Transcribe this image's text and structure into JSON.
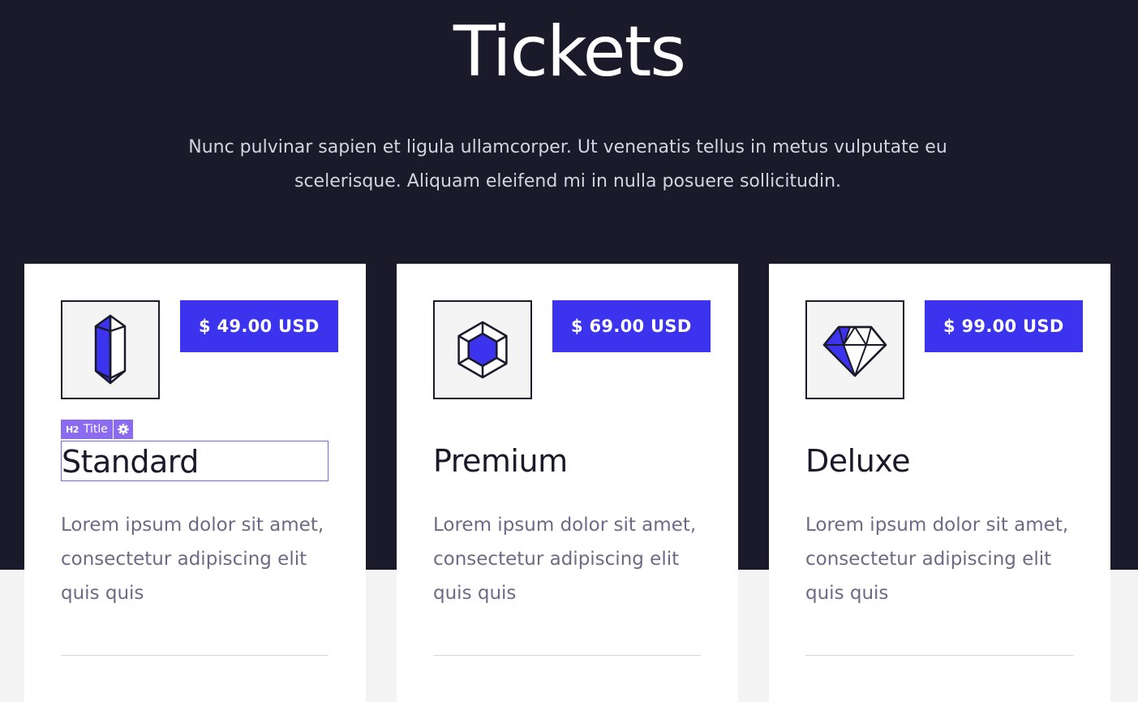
{
  "hero": {
    "title": "Tickets",
    "subtitle": "Nunc pulvinar sapien et ligula ullamcorper. Ut venenatis tellus in metus vulputate eu scelerisque. Aliquam eleifend mi in nulla posuere sollicitudin."
  },
  "editor_tag": {
    "heading_level": "H2",
    "label": "Title",
    "settings_icon": "gear-icon"
  },
  "cards": [
    {
      "icon": "crystal-icon",
      "price": "$ 49.00 USD",
      "title": "Standard",
      "text": "Lorem ipsum dolor sit amet, consectetur adipiscing elit quis quis"
    },
    {
      "icon": "hexagon-gem-icon",
      "price": "$ 69.00 USD",
      "title": "Premium",
      "text": "Lorem ipsum dolor sit amet, consectetur adipiscing elit quis quis"
    },
    {
      "icon": "diamond-icon",
      "price": "$ 99.00 USD",
      "title": "Deluxe",
      "text": "Lorem ipsum dolor sit amet, consectetur adipiscing elit quis quis"
    }
  ],
  "colors": {
    "hero_background": "#1a1a2b",
    "accent": "#3b33ee",
    "editor_highlight": "#8b6cf0",
    "body_text": "#6b6b85"
  }
}
